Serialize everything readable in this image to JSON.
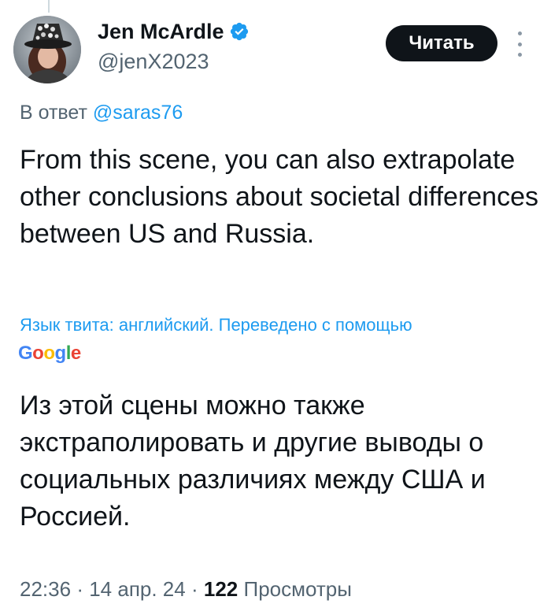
{
  "author": {
    "display_name": "Jen McArdle",
    "handle": "@jenX2023",
    "verified": true
  },
  "header": {
    "read_button_label": "Читать",
    "more_icon": "more-vertical-icon"
  },
  "reply": {
    "prefix": "В ответ",
    "mention": "@saras76"
  },
  "tweet": {
    "text": "From this scene, you can also extrapolate other conclusions about societal differences between US and Russia."
  },
  "translation": {
    "note": "Язык твита: английский. Переведено с помощью",
    "provider_letters": [
      "G",
      "o",
      "o",
      "g",
      "l",
      "e"
    ],
    "provider_colors": [
      "#4285f4",
      "#ea4335",
      "#fbbc05",
      "#4285f4",
      "#34a853",
      "#ea4335"
    ],
    "text": "Из этой сцены можно также экстраполировать и другие выводы о социальных различиях между США и Россией."
  },
  "meta": {
    "time": "22:36",
    "separator": "·",
    "date": "14 апр. 24",
    "views_count": "122",
    "views_label": "Просмотры"
  },
  "colors": {
    "accent": "#1d9bf0",
    "text": "#0f1419",
    "secondary": "#536471",
    "button_bg": "#0f1419"
  }
}
